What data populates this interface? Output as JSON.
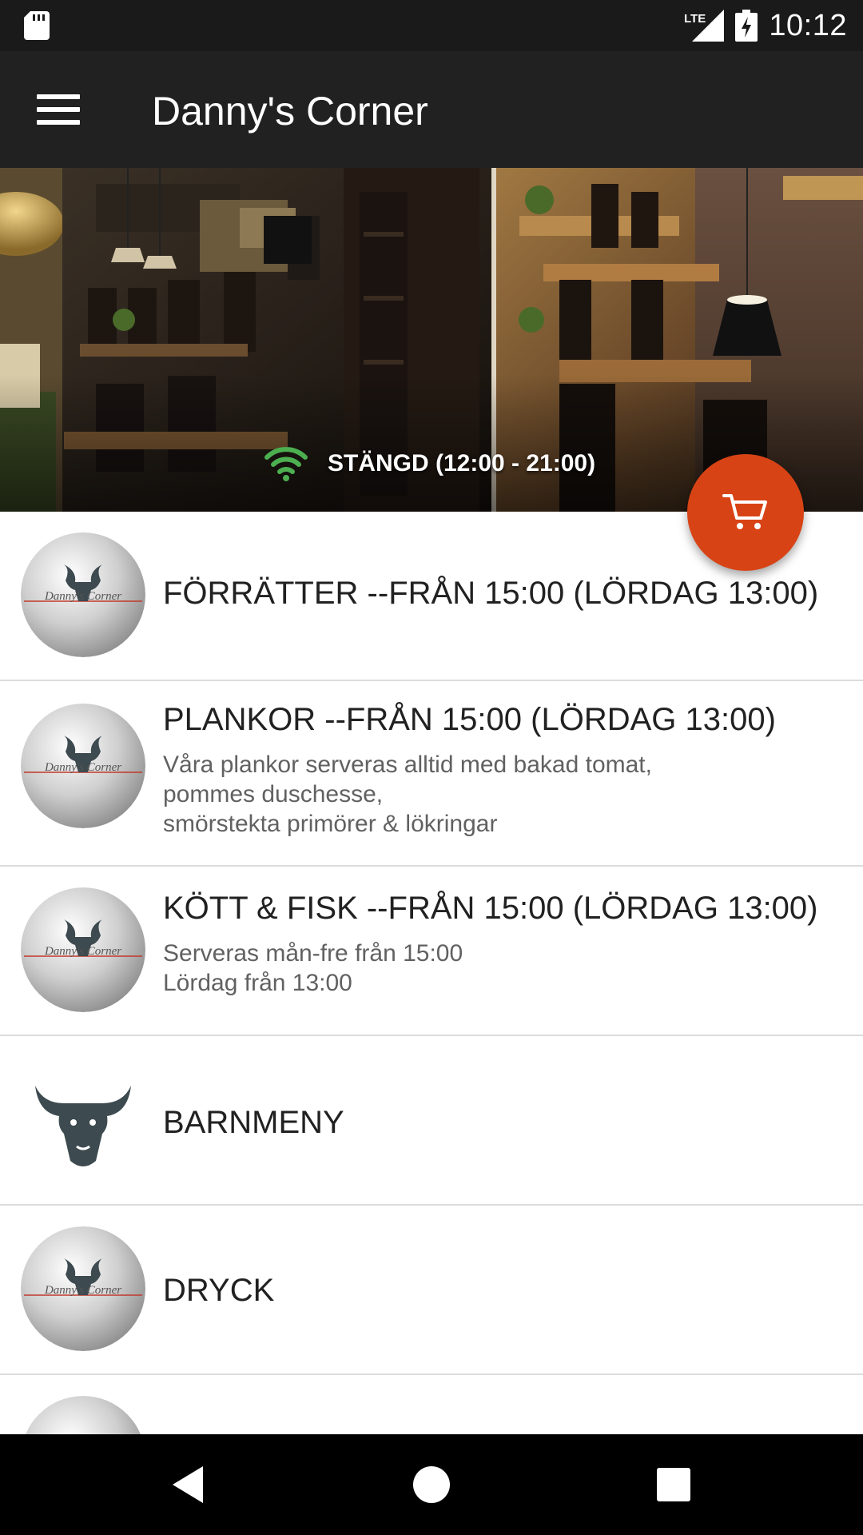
{
  "status_bar": {
    "network": "LTE",
    "time": "10:12",
    "icons": [
      "sd-card-icon",
      "lte-signal-icon",
      "battery-charging-icon"
    ]
  },
  "app_bar": {
    "title": "Danny's Corner",
    "menu_icon": "hamburger-menu-icon"
  },
  "hero": {
    "status_text": "STÄNGD (12:00 - 21:00)",
    "status_icon": "wifi-icon",
    "status_icon_color": "#4caf50"
  },
  "fab": {
    "icon": "cart-icon",
    "color": "#d84315"
  },
  "categories": [
    {
      "title": "FÖRRÄTTER --FRÅN 15:00 (LÖRDAG 13:00)",
      "description": [],
      "image": "dannys-corner-logo-sphere",
      "logo_text": "Danny's Corner"
    },
    {
      "title": "PLANKOR --FRÅN 15:00 (LÖRDAG 13:00)",
      "description": [
        "Våra plankor serveras alltid med bakad tomat,",
        "pommes duschesse,",
        "smörstekta primörer & lökringar"
      ],
      "image": "dannys-corner-logo-sphere",
      "logo_text": "Danny's Corner"
    },
    {
      "title": "KÖTT & FISK --FRÅN 15:00 (LÖRDAG 13:00)",
      "description": [
        "Serveras mån-fre från 15:00",
        "Lördag från 13:00"
      ],
      "image": "dannys-corner-logo-sphere",
      "logo_text": "Danny's Corner"
    },
    {
      "title": "BARNMENY",
      "description": [],
      "image": "bull-head-icon"
    },
    {
      "title": "DRYCK",
      "description": [],
      "image": "dannys-corner-logo-sphere",
      "logo_text": "Danny's Corner"
    },
    {
      "title": "",
      "description": [],
      "image": "dannys-corner-logo-sphere"
    }
  ],
  "nav_bar": {
    "buttons": [
      "back-icon",
      "home-icon",
      "recents-icon"
    ]
  },
  "colors": {
    "status_bar": "#1a1a1a",
    "app_bar": "#212121",
    "accent": "#d84315",
    "divider": "#dcdcdc"
  }
}
